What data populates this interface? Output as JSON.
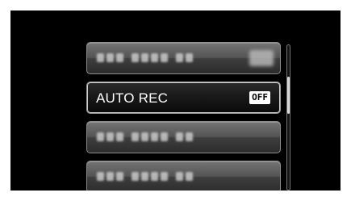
{
  "menu": {
    "items": [
      {
        "label": "",
        "value": "",
        "selected": false
      },
      {
        "label": "AUTO REC",
        "value": "OFF",
        "selected": true
      },
      {
        "label": "",
        "value": "",
        "selected": false
      },
      {
        "label": "",
        "value": "",
        "selected": false
      }
    ]
  },
  "colors": {
    "screen_background": "#000000",
    "page_background": "#ffffff",
    "selected_text": "#ffffff",
    "badge_background": "#ffffff"
  },
  "icons": [
    "scrollbar"
  ]
}
